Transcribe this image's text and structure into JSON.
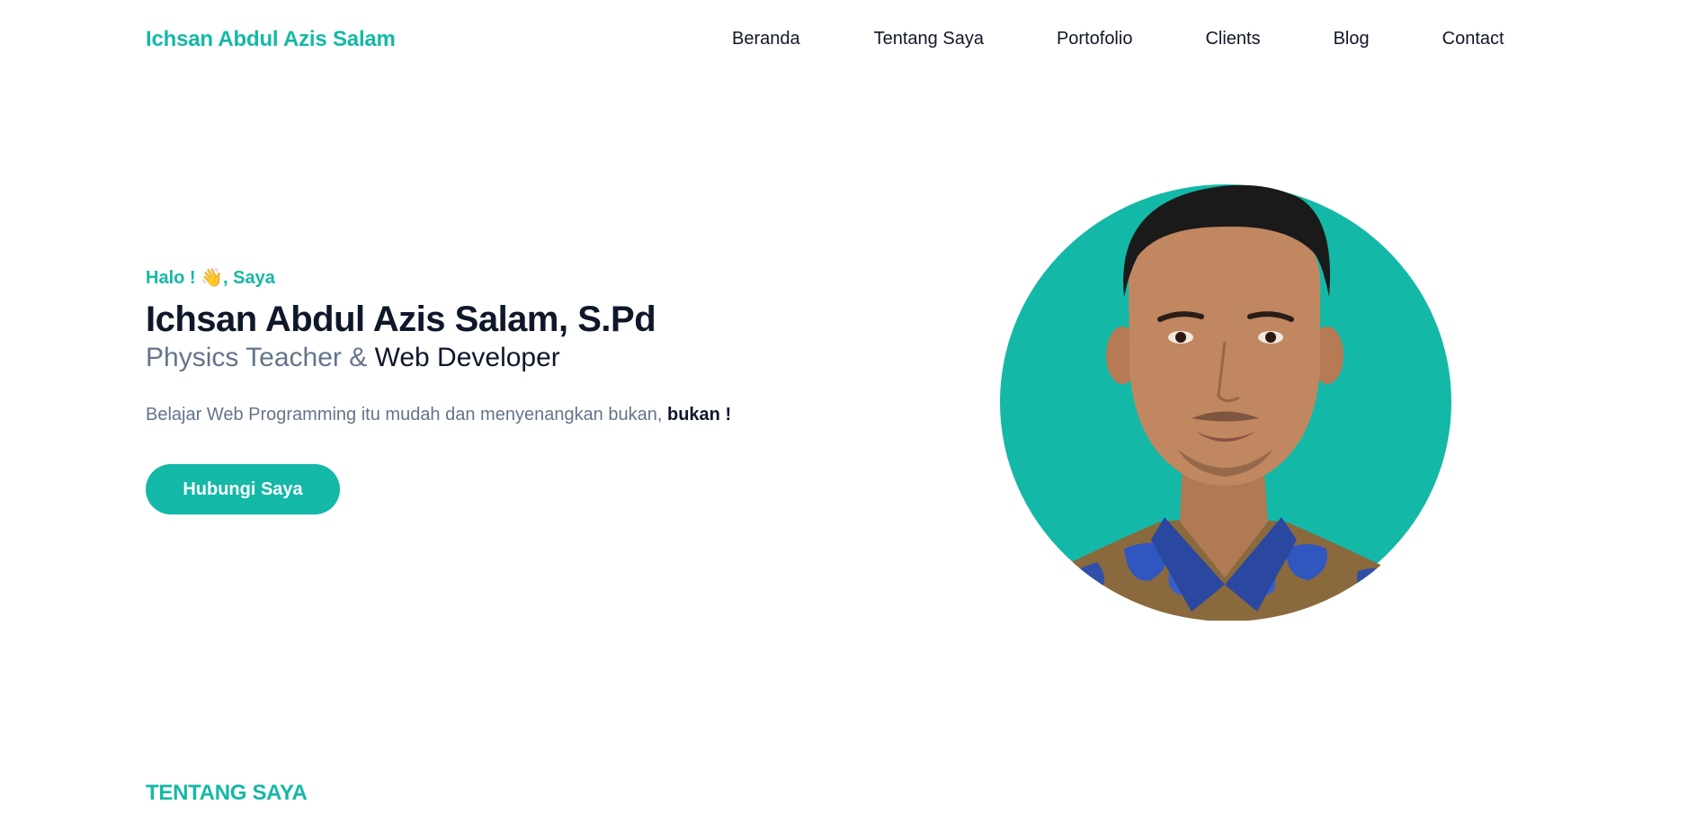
{
  "header": {
    "brand": "Ichsan Abdul Azis Salam",
    "nav": [
      {
        "label": "Beranda"
      },
      {
        "label": "Tentang Saya"
      },
      {
        "label": "Portofolio"
      },
      {
        "label": "Clients"
      },
      {
        "label": "Blog"
      },
      {
        "label": "Contact"
      }
    ]
  },
  "hero": {
    "greeting_prefix": "Halo ! ",
    "greeting_emoji": "👋",
    "greeting_suffix": ", Saya",
    "name": "Ichsan Abdul Azis Salam, S.Pd",
    "role_muted": "Physics Teacher & ",
    "role_strong": "Web Developer",
    "tagline_text": "Belajar Web Programming itu mudah dan menyenangkan bukan, ",
    "tagline_bold": "bukan !",
    "cta_label": "Hubungi Saya",
    "portrait_icon": "person-portrait"
  },
  "about": {
    "section_label": "TENTANG SAYA"
  },
  "colors": {
    "accent": "#14b8a6",
    "text_dark": "#0f172a",
    "text_muted": "#64748b"
  }
}
